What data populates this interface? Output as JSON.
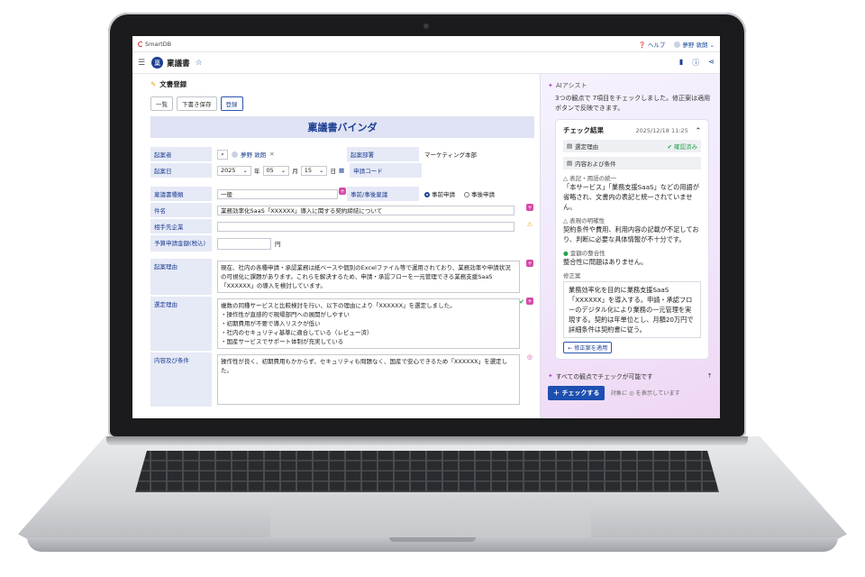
{
  "topbar": {
    "logo_text": "SmartDB",
    "help_label": "ヘルプ",
    "user_name": "夢野 敦朗"
  },
  "titlebar": {
    "badge": "稟",
    "title": "稟議書"
  },
  "form": {
    "section_title": "文書登録",
    "buttons": {
      "list": "一覧",
      "draft": "下書き保存",
      "register": "登録"
    },
    "title": "稟議書バインダ",
    "fields": {
      "applicant_label": "起案者",
      "applicant_name": "夢野 敦朗",
      "dept_label": "起案部署",
      "dept_value": "マーケティング本部",
      "date_label": "起案日",
      "year": "2025",
      "year_unit": "年",
      "month": "05",
      "month_unit": "月",
      "day": "15",
      "day_unit": "日",
      "code_label": "申請コード",
      "type_label": "稟議書種類",
      "type_value": "一般",
      "timing_label": "事前/事後稟議",
      "timing_pre": "事前申請",
      "timing_post": "事後申請",
      "subject_label": "件名",
      "subject_value": "業務効率化SaaS「XXXXXX」導入に関する契約締結について",
      "partner_label": "相手先企業",
      "partner_value": "",
      "amount_label": "予算申請金額(税込)",
      "amount_value": "",
      "amount_unit": "円",
      "reason_label": "起案理由",
      "reason_value": "現在、社内の各種申請・承認業務は紙ベースや個別のExcelファイル等で運用されており、業務効率や申請状況の可視化に課題があります。これらを解決するため、申請・承認フローを一元管理できる業務支援SaaS「XXXXXX」の導入を検討しています。",
      "selection_label": "選定理由",
      "selection_intro": "複数の同種サービスと比較検討を行い、以下の理由により「XXXXXX」を選定しました。",
      "selection_items": [
        "操作性が直感的で現場部門への展開がしやすい",
        "初期費用が不要で導入リスクが低い",
        "社内のセキュリティ基準に適合している（レビュー済）",
        "国産サービスでサポート体制が充実している"
      ],
      "terms_label": "内容及び条件",
      "terms_value": "操作性が良く、初期費用もかからず、セキュリティも問題なく、国産で安心できるため「XXXXXX」を選定した。"
    }
  },
  "ai": {
    "title": "AIアシスト",
    "intro": "3つの観点で 7項目をチェックしました。修正案は適用ボタンで反映できます。",
    "card_title": "チェック結果",
    "card_date": "2025/12/18 11:25",
    "tag1": "選定理由",
    "tag1_status": "確認済み",
    "tag2": "内容および条件",
    "check1_title": "表記・用語の統一",
    "check1_body": "「本サービス」「業務支援SaaS」などの用語が省略され、文書内の表記と統一されていません。",
    "check2_title": "表現の明確性",
    "check2_body": "契約条件や費用、利用内容の記載が不足しており、判断に必要な具体情報が不十分です。",
    "check3_title": "金額の整合性",
    "check3_body": "整合性に問題はありません。",
    "suggest_label": "修正案",
    "suggest_body": "業務効率化を目的に業務支援SaaS「XXXXXX」を導入する。申請・承認フローのデジタル化により業務の一元管理を実現する。契約は年単位とし、月額20万円で詳細条件は契約書に従う。",
    "apply_label": "修正案を適用",
    "footer_text": "すべての観点でチェックが可能です",
    "check_button": "チェックする",
    "footer_note": "対象に ◎ を表示しています"
  }
}
